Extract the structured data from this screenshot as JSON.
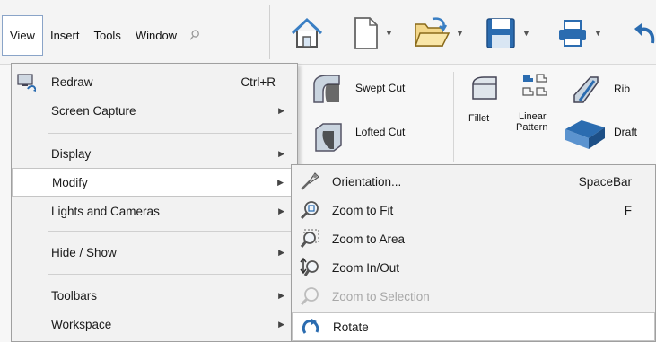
{
  "menubar": {
    "items": [
      "View",
      "Insert",
      "Tools",
      "Window"
    ],
    "pin_icon": "pin-icon"
  },
  "quick_access": {
    "icons": [
      "home-icon",
      "new-document-icon",
      "open-folder-icon",
      "save-icon",
      "print-icon",
      "undo-icon"
    ]
  },
  "ribbon": {
    "swept_cut": "Swept Cut",
    "lofted_cut": "Lofted Cut",
    "fillet": "Fillet",
    "linear_pattern_line1": "Linear",
    "linear_pattern_line2": "Pattern",
    "rib": "Rib",
    "draft": "Draft"
  },
  "view_menu": {
    "items": [
      {
        "label": "Redraw",
        "shortcut": "Ctrl+R",
        "icon": "redraw-icon",
        "submenu": false
      },
      {
        "label": "Screen Capture",
        "shortcut": "",
        "submenu": true
      },
      {
        "label": "Display",
        "shortcut": "",
        "submenu": true
      },
      {
        "label": "Modify",
        "shortcut": "",
        "submenu": true,
        "highlighted": true
      },
      {
        "label": "Lights and Cameras",
        "shortcut": "",
        "submenu": true
      },
      {
        "label": "Hide / Show",
        "shortcut": "",
        "submenu": true
      },
      {
        "label": "Toolbars",
        "shortcut": "",
        "submenu": true
      },
      {
        "label": "Workspace",
        "shortcut": "",
        "submenu": true
      }
    ]
  },
  "modify_submenu": {
    "items": [
      {
        "label": "Orientation...",
        "shortcut": "SpaceBar",
        "icon": "orientation-icon",
        "enabled": true
      },
      {
        "label": "Zoom to Fit",
        "shortcut": "F",
        "icon": "zoom-to-fit-icon",
        "enabled": true
      },
      {
        "label": "Zoom to Area",
        "shortcut": "",
        "icon": "zoom-to-area-icon",
        "enabled": true
      },
      {
        "label": "Zoom In/Out",
        "shortcut": "",
        "icon": "zoom-in-out-icon",
        "enabled": true
      },
      {
        "label": "Zoom to Selection",
        "shortcut": "",
        "icon": "zoom-to-selection-icon",
        "enabled": false
      },
      {
        "label": "Rotate",
        "shortcut": "",
        "icon": "rotate-icon",
        "enabled": true
      }
    ]
  },
  "colors": {
    "accent_blue": "#2b6cb0",
    "menu_bg": "#f2f2f2",
    "disabled_text": "#a8a8a8"
  }
}
